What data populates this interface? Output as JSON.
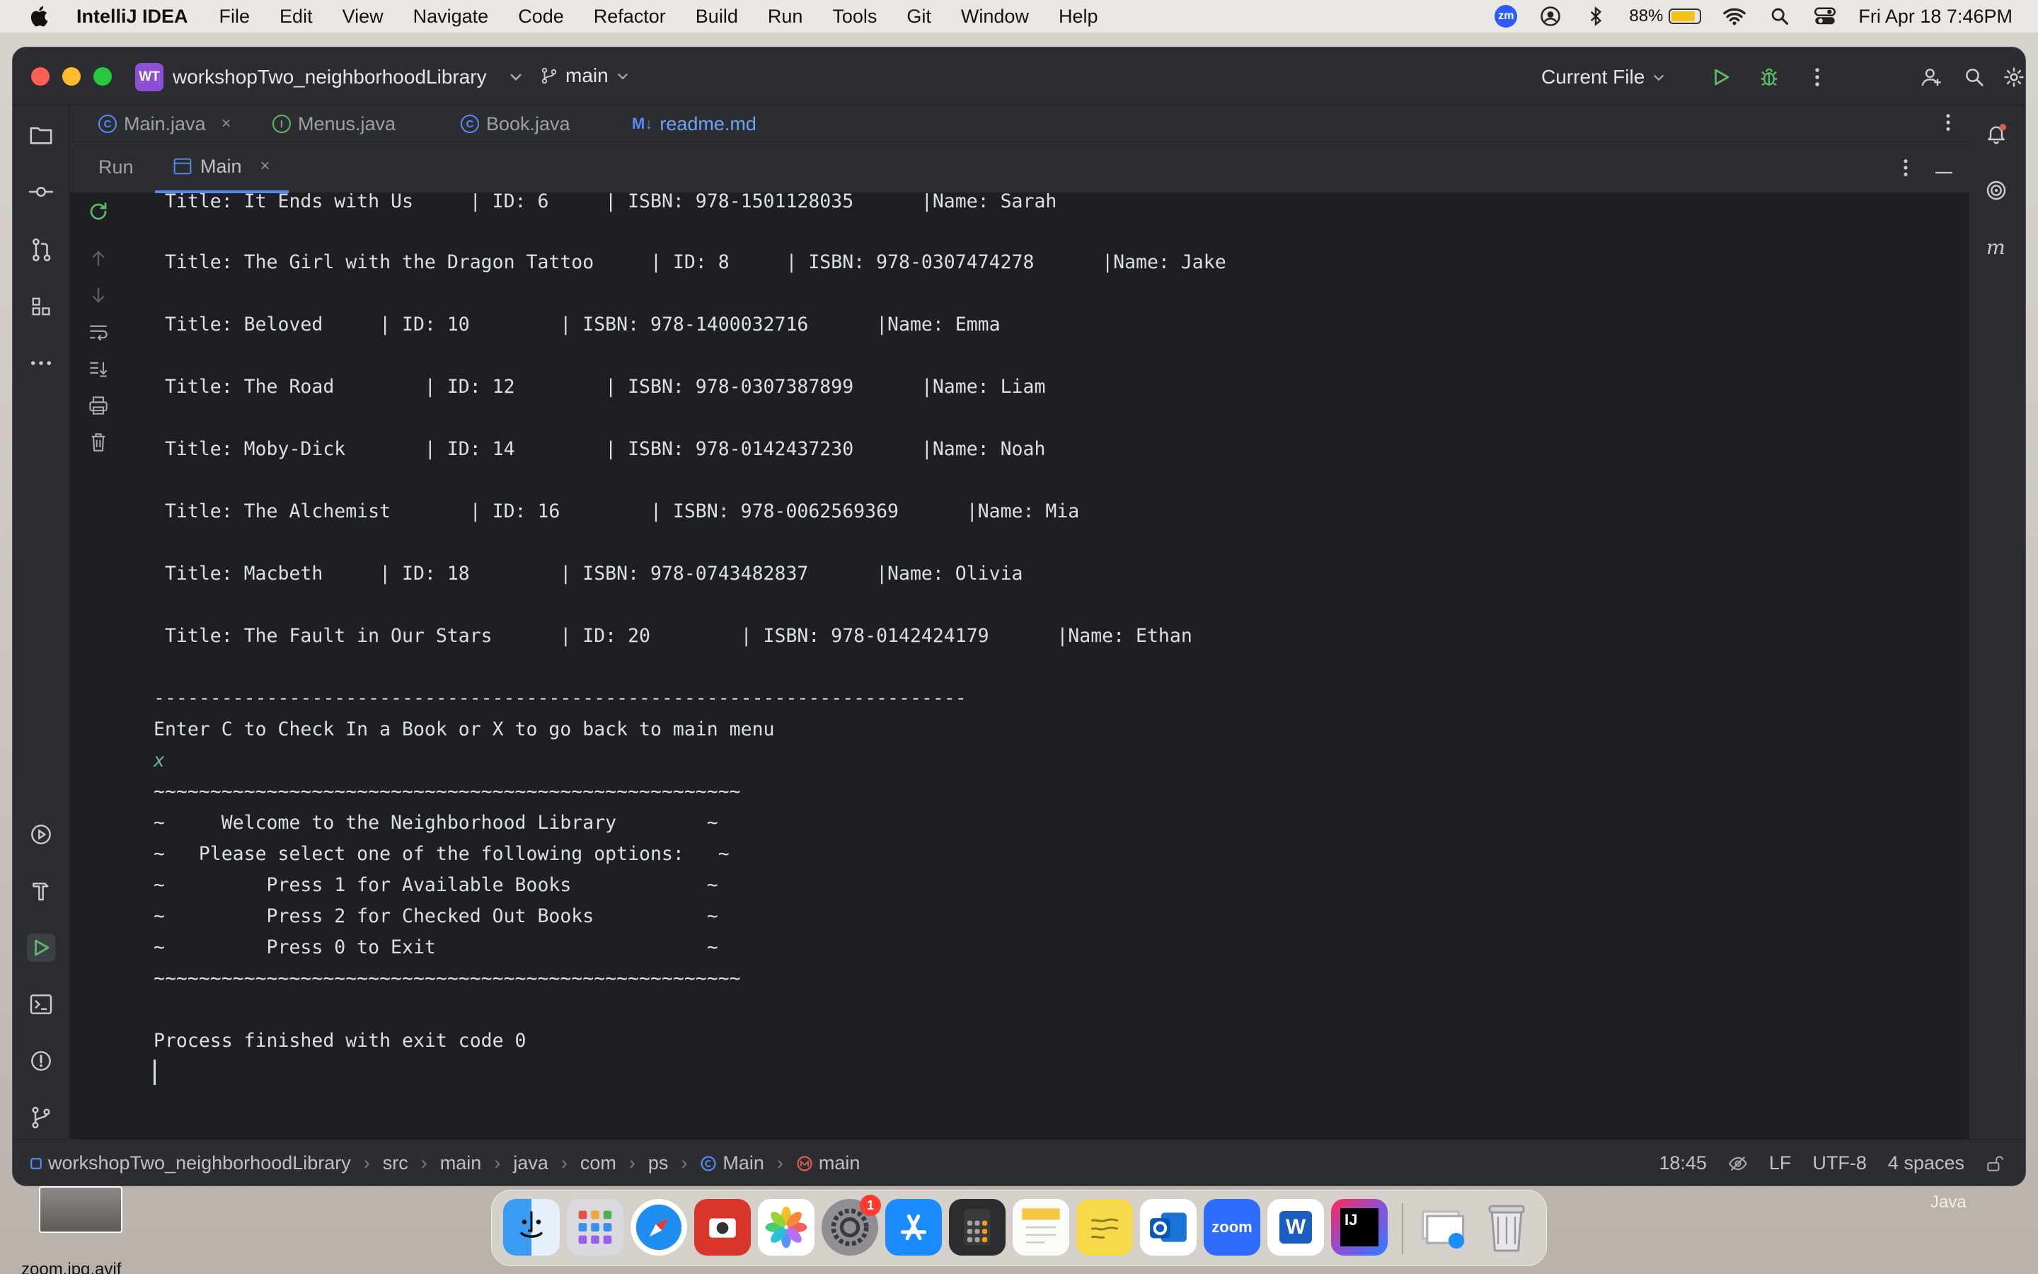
{
  "menubar": {
    "app_name": "IntelliJ IDEA",
    "items": [
      "File",
      "Edit",
      "View",
      "Navigate",
      "Code",
      "Refactor",
      "Build",
      "Run",
      "Tools",
      "Git",
      "Window",
      "Help"
    ],
    "zoom_badge": "zm",
    "battery": "88%",
    "clock": "Fri Apr 18  7:46PM"
  },
  "window": {
    "project_badge": "WT",
    "project_name": "workshopTwo_neighborhoodLibrary",
    "branch": "main",
    "run_config": "Current File"
  },
  "editor_tabs": [
    {
      "label": "Main.java",
      "icon": "C"
    },
    {
      "label": "Menus.java",
      "icon": "I"
    },
    {
      "label": "Book.java",
      "icon": "C"
    },
    {
      "label": "readme.md",
      "icon": "M↓"
    }
  ],
  "run_panel": {
    "title": "Run",
    "tab_label": "Main"
  },
  "console": {
    "lines": [
      " Title: It Ends with Us     | ID: 6     | ISBN: 978-1501128035      |Name: Sarah",
      " Title: The Girl with the Dragon Tattoo     | ID: 8     | ISBN: 978-0307474278      |Name: Jake",
      " Title: Beloved     | ID: 10        | ISBN: 978-1400032716      |Name: Emma",
      " Title: The Road        | ID: 12        | ISBN: 978-0307387899      |Name: Liam",
      " Title: Moby-Dick       | ID: 14        | ISBN: 978-0142437230      |Name: Noah",
      " Title: The Alchemist       | ID: 16        | ISBN: 978-0062569369      |Name: Mia",
      " Title: Macbeth     | ID: 18        | ISBN: 978-0743482837      |Name: Olivia",
      " Title: The Fault in Our Stars      | ID: 20        | ISBN: 978-0142424179      |Name: Ethan",
      "------------------------------------------------------------------------",
      "Enter C to Check In a Book or X to go back to main menu",
      "x",
      "~~~~~~~~~~~~~~~~~~~~~~~~~~~~~~~~~~~~~~~~~~~~~~~~~~~~",
      "~     Welcome to the Neighborhood Library        ~",
      "~   Please select one of the following options:   ~",
      "~         Press 1 for Available Books            ~",
      "~         Press 2 for Checked Out Books          ~",
      "~         Press 0 to Exit                        ~",
      "~~~~~~~~~~~~~~~~~~~~~~~~~~~~~~~~~~~~~~~~~~~~~~~~~~~~",
      "Process finished with exit code 0"
    ]
  },
  "statusbar": {
    "breadcrumbs": [
      "workshopTwo_neighborhoodLibrary",
      "src",
      "main",
      "java",
      "com",
      "ps",
      "Main",
      "main"
    ],
    "position": "18:45",
    "line_separator": "LF",
    "encoding": "UTF-8",
    "indent": "4 spaces"
  },
  "desktop": {
    "file_label": "zoom.jpg.avif",
    "dock_hint": "Java"
  },
  "dock": {
    "settings_badge": "1",
    "zoom_label": "zoom",
    "word_label": "W",
    "intellij_label": "IJ"
  }
}
